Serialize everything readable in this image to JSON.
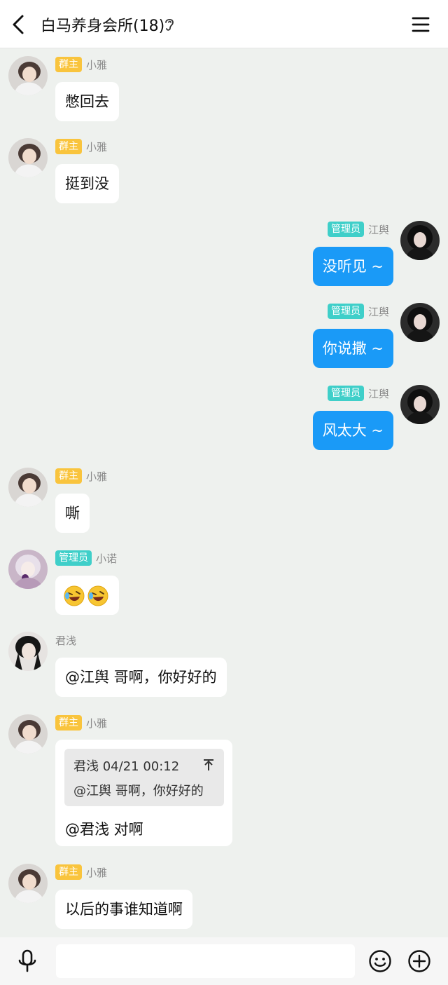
{
  "header": {
    "title": "白马养身会所(18)",
    "back_icon": "chevron-left-icon",
    "mode_icon": "ear-icon",
    "menu_icon": "hamburger-menu-icon"
  },
  "roles": {
    "owner": "群主",
    "admin": "管理员"
  },
  "colors": {
    "owner_badge": "#f9c43d",
    "admin_badge": "#3fcfc9",
    "outgoing_bubble": "#1a9af7",
    "background": "#eef1ee"
  },
  "messages": [
    {
      "side": "left",
      "sender": "小雅",
      "role": "群主",
      "text": "憋回去"
    },
    {
      "side": "left",
      "sender": "小雅",
      "role": "群主",
      "text": "挺到没"
    },
    {
      "side": "right",
      "sender": "江舆",
      "role": "管理员",
      "text": "没听见 ~"
    },
    {
      "side": "right",
      "sender": "江舆",
      "role": "管理员",
      "text": "你说撒 ~"
    },
    {
      "side": "right",
      "sender": "江舆",
      "role": "管理员",
      "text": "风太大 ~"
    },
    {
      "side": "left",
      "sender": "小雅",
      "role": "群主",
      "text": "嘶"
    },
    {
      "side": "left",
      "sender": "小诺",
      "role": "管理员",
      "emojis": [
        "rolling-laughing-emoji",
        "rolling-laughing-emoji"
      ]
    },
    {
      "side": "left",
      "sender": "君浅",
      "role": "",
      "text": "@江舆 哥啊，你好好的"
    },
    {
      "side": "left",
      "sender": "小雅",
      "role": "群主",
      "quote": {
        "header": "君浅 04/21 00:12",
        "text": "@江舆 哥啊，你好好的",
        "jump_icon": "jump-to-top-icon"
      },
      "text": "@君浅 对啊"
    },
    {
      "side": "left",
      "sender": "小雅",
      "role": "群主",
      "text": "以后的事谁知道啊"
    }
  ],
  "input": {
    "value": "",
    "voice_icon": "microphone-icon",
    "emoji_icon": "smiley-icon",
    "more_icon": "plus-circle-icon"
  }
}
